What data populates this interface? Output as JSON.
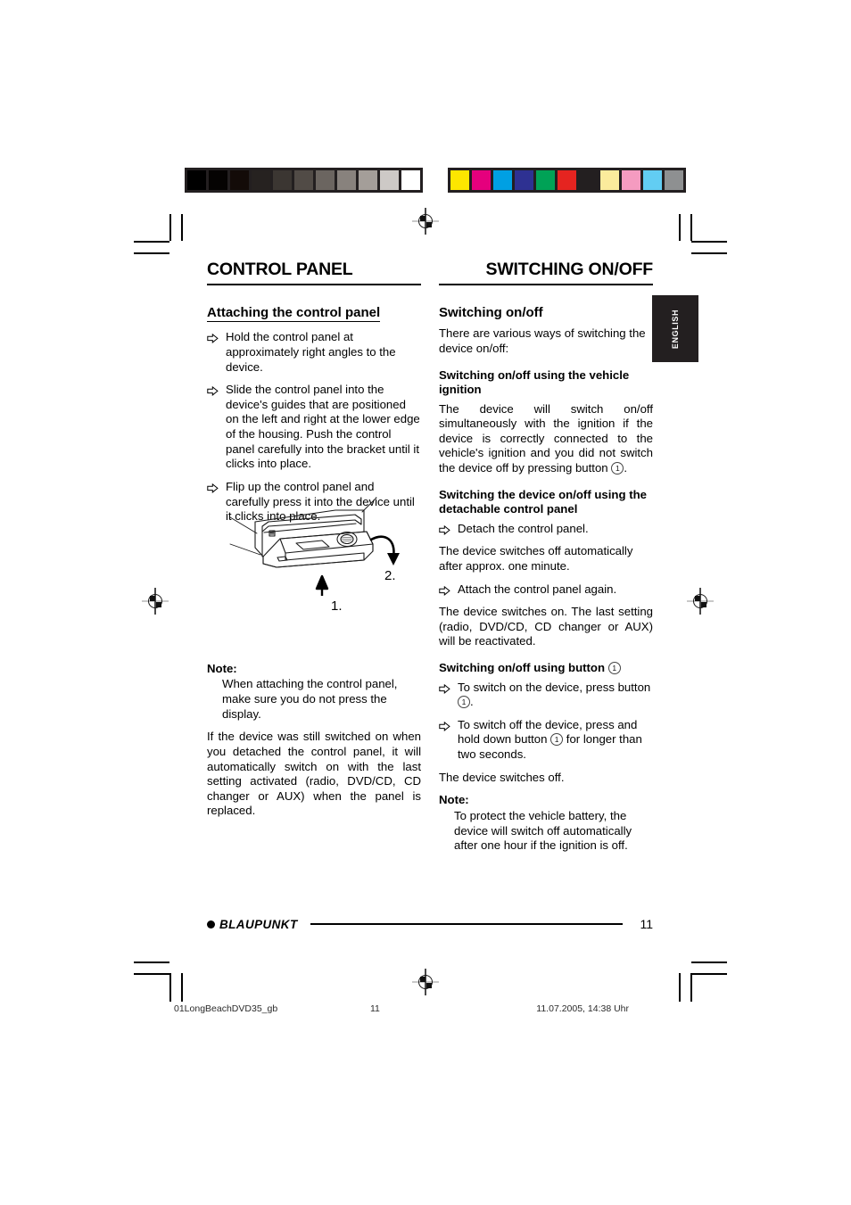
{
  "print_marks": {
    "grey_bar": {
      "name": "greyscale-calibration-bar",
      "swatches": [
        "#000000",
        "#050302",
        "#130b08",
        "#262220",
        "#3b3632",
        "#514b46",
        "#6b6560",
        "#88827d",
        "#a49e99",
        "#cdc9c6",
        "#ffffff"
      ]
    },
    "color_bar": {
      "name": "color-calibration-bar",
      "swatches": [
        "#fde600",
        "#e5007d",
        "#00a0e3",
        "#2e3192",
        "#00a256",
        "#e52420",
        "#231f20",
        "#fbeb9c",
        "#f59bc0",
        "#62cdf3",
        "#8e9091"
      ]
    }
  },
  "side_tab": {
    "label": "ENGLISH"
  },
  "left_column": {
    "chapter_title": "CONTROL PANEL",
    "section_title": "Attaching the control panel",
    "steps": [
      "Hold the control panel at approximately right angles to the device.",
      "Slide the control panel into the device's guides that are positioned on the left and right at the lower edge of the housing. Push the control panel carefully into the bracket until it clicks into place.",
      "Flip up the control panel and carefully press it into the device until it clicks into place."
    ],
    "illustration": {
      "name": "car-radio-detachable-panel-diagram",
      "callout_1": "1.",
      "callout_2": "2."
    },
    "note_label": "Note:",
    "note_body": "When attaching the control panel, make sure you do not press the display.",
    "closing_paragraph": "If the device was still switched on when you detached the control panel, it will automatically switch on with the last setting activated (radio, DVD/CD, CD changer or AUX) when the panel is replaced."
  },
  "right_column": {
    "chapter_title": "SWITCHING ON/OFF",
    "section_title": "Switching on/off",
    "intro": "There are various ways of switching the device on/off:",
    "sub1": {
      "heading": "Switching on/off using the vehicle ignition",
      "body_before": "The device will switch on/off simultaneously with the ignition if the device is correctly connected to the vehicle's ignition and you did not switch the device off by pressing button ",
      "button_ref": "1",
      "body_after": "."
    },
    "sub2": {
      "heading": "Switching the device on/off using the detachable control panel",
      "step1": "Detach the control panel.",
      "para1": "The device switches off automatically after approx. one minute.",
      "step2": "Attach the control panel again.",
      "para2": "The device switches on. The last setting (radio, DVD/CD, CD changer or AUX) will be reactivated."
    },
    "sub3": {
      "heading_before": "Switching on/off using button ",
      "heading_button_ref": "1",
      "step1_before": "To switch on the device, press button ",
      "step1_ref": "1",
      "step1_after": ".",
      "step2_before": "To switch off the device, press and hold down button ",
      "step2_ref": "1",
      "step2_after": " for longer than two seconds.",
      "para1": "The device switches off."
    },
    "note_label": "Note:",
    "note_body": "To protect the vehicle battery, the device will switch off automatically after one hour if the ignition is off."
  },
  "footer": {
    "brand": "BLAUPUNKT",
    "page_number": "11"
  },
  "meta_strip": {
    "file_name": "01LongBeachDVD35_gb",
    "page_number": "11",
    "timestamp": "11.07.2005, 14:38 Uhr"
  }
}
